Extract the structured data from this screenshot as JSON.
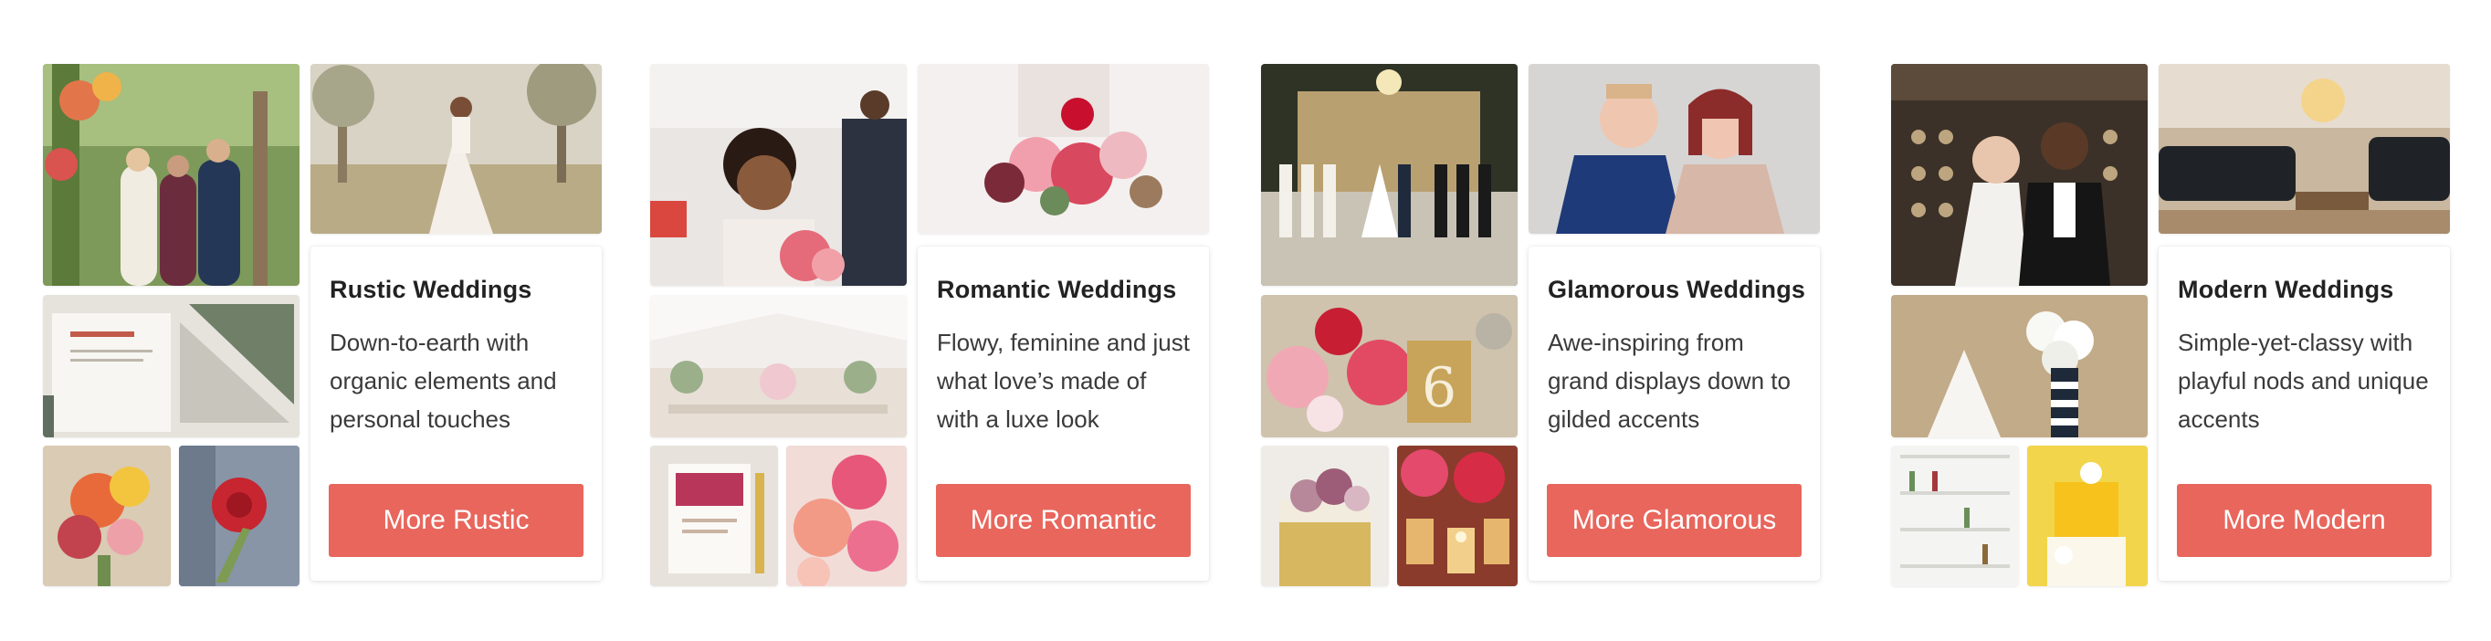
{
  "styles": [
    {
      "title": "Rustic Weddings",
      "description": "Down-to-earth with organic elements and personal touches",
      "button": "More Rustic",
      "photos": [
        "rustic-arch-ceremony-photo",
        "rustic-bride-field-photo",
        "rustic-invitation-photo",
        "rustic-bouquet-photo",
        "rustic-boutonniere-photo"
      ]
    },
    {
      "title": "Romantic Weddings",
      "description": "Flowy, feminine and just what love’s made of with a luxe look",
      "button": "More Romantic",
      "photos": [
        "romantic-laughing-bride-photo",
        "romantic-bouquet-photo",
        "romantic-tent-reception-photo",
        "romantic-invitation-photo",
        "romantic-peony-photo"
      ]
    },
    {
      "title": "Glamorous Weddings",
      "description": "Awe-inspiring from grand displays down to gilded accents",
      "button": "More Glamorous",
      "photos": [
        "glamorous-ballroom-ceremony-photo",
        "glamorous-couple-portrait-photo",
        "glamorous-centerpiece-photo",
        "glamorous-cake-photo",
        "glamorous-candles-photo"
      ]
    },
    {
      "title": "Modern Weddings",
      "description": "Simple-yet-classy with playful nods and unique accents",
      "button": "More Modern",
      "photos": [
        "modern-couple-portrait-photo",
        "modern-lounge-photo",
        "modern-bouquet-photo",
        "modern-bar-shelves-photo",
        "modern-yellow-cake-photo"
      ]
    }
  ],
  "colors": {
    "button": "#e8665c",
    "button_text": "#ffffff",
    "title": "#222222",
    "body": "#3a3a3a"
  }
}
